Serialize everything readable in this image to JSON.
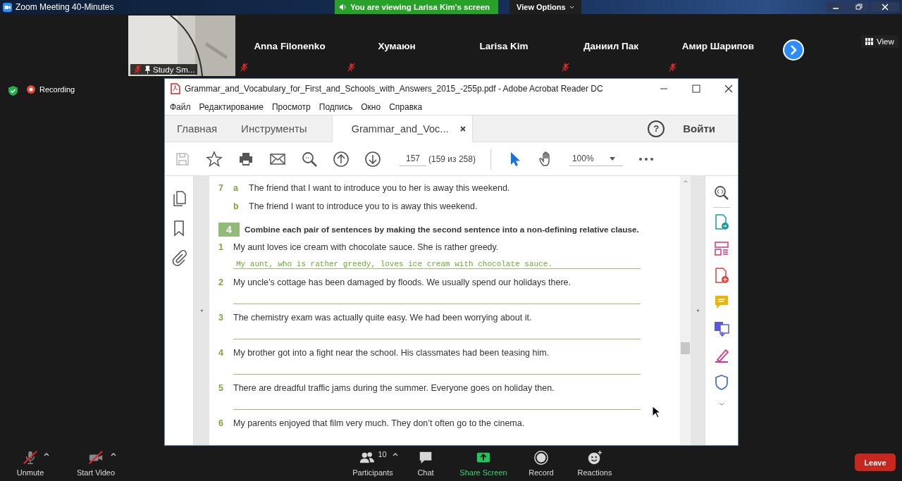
{
  "zoom_window": {
    "title": "Zoom Meeting 40-Minutes"
  },
  "share_banner": {
    "text": "You are viewing Larisa Kim's screen",
    "view_options": "View Options"
  },
  "participants": [
    {
      "name": "Study Sm...",
      "kind": "video",
      "muted": true,
      "pinned": true
    },
    {
      "name": "Anna Filonenko",
      "kind": "name",
      "muted": true,
      "pinned": false
    },
    {
      "name": "Хумаюн",
      "kind": "name",
      "muted": true,
      "pinned": false
    },
    {
      "name": "Larisa Kim",
      "kind": "name",
      "muted": false,
      "pinned": false
    },
    {
      "name": "Даниил Пак",
      "kind": "name",
      "muted": true,
      "pinned": false
    },
    {
      "name": "Амир Шарипов",
      "kind": "name",
      "muted": true,
      "pinned": false
    }
  ],
  "view_button": "View",
  "recording": "Recording",
  "acrobat": {
    "title": "Grammar_and_Vocabulary_for_First_and_Schools_with_Answers_2015_-255p.pdf - Adobe Acrobat Reader DC",
    "menu": [
      "Файл",
      "Редактирование",
      "Просмотр",
      "Подпись",
      "Окно",
      "Справка"
    ],
    "tabs": [
      {
        "label": "Главная",
        "selected": false,
        "closable": false
      },
      {
        "label": "Инструменты",
        "selected": false,
        "closable": false
      },
      {
        "label": "Grammar_and_Voc...",
        "selected": true,
        "closable": true
      }
    ],
    "help": "?",
    "sign_in": "Войти",
    "page_number": "157",
    "page_info": "(159 из 258)",
    "zoom": "100%"
  },
  "document": {
    "previous": [
      {
        "number": "7",
        "letter": "a",
        "text": "The friend that I want to introduce you to her is away this weekend."
      },
      {
        "letter": "b",
        "text": "The friend I want to introduce you to is away this weekend."
      }
    ],
    "exercise": {
      "number": "4",
      "instruction": "Combine each pair of sentences by making the second sentence into a non-defining relative clause."
    },
    "items": [
      {
        "number": "1",
        "kind": "lined",
        "text": "My aunt loves ice cream with chocolate sauce. She is rather greedy.",
        "answer": "My aunt, who is rather greedy, loves ice cream with chocolate sauce."
      },
      {
        "number": "2",
        "kind": "lined",
        "text": "My uncle’s cottage has been damaged by floods. We usually spend our holidays there."
      },
      {
        "number": "3",
        "kind": "lined",
        "text": "The chemistry exam was actually quite easy. We had been worrying about it."
      },
      {
        "number": "4",
        "kind": "lined",
        "text": "My brother got into a fight near the school. His classmates had been teasing him."
      },
      {
        "number": "5",
        "kind": "lined",
        "text": "There are dreadful traffic jams during the summer. Everyone goes on holiday then."
      },
      {
        "number": "6",
        "kind": "plain",
        "text": "My parents enjoyed that film very much. They don’t often go to the cinema."
      }
    ]
  },
  "toolbar": [
    {
      "label": "Unmute",
      "kind": "mic",
      "off": true,
      "caret": true
    },
    {
      "label": "Start Video",
      "kind": "video",
      "off": true,
      "caret": true
    },
    {
      "label": "Participants",
      "kind": "participants",
      "count": "10",
      "off": false,
      "caret": true
    },
    {
      "label": "Chat",
      "kind": "chat",
      "off": false,
      "caret": false
    },
    {
      "label": "Share Screen",
      "kind": "share",
      "off": false,
      "caret": false
    },
    {
      "label": "Record",
      "kind": "record",
      "off": false,
      "caret": false
    },
    {
      "label": "Reactions",
      "kind": "reactions",
      "off": false,
      "caret": false
    }
  ],
  "leave": "Leave"
}
